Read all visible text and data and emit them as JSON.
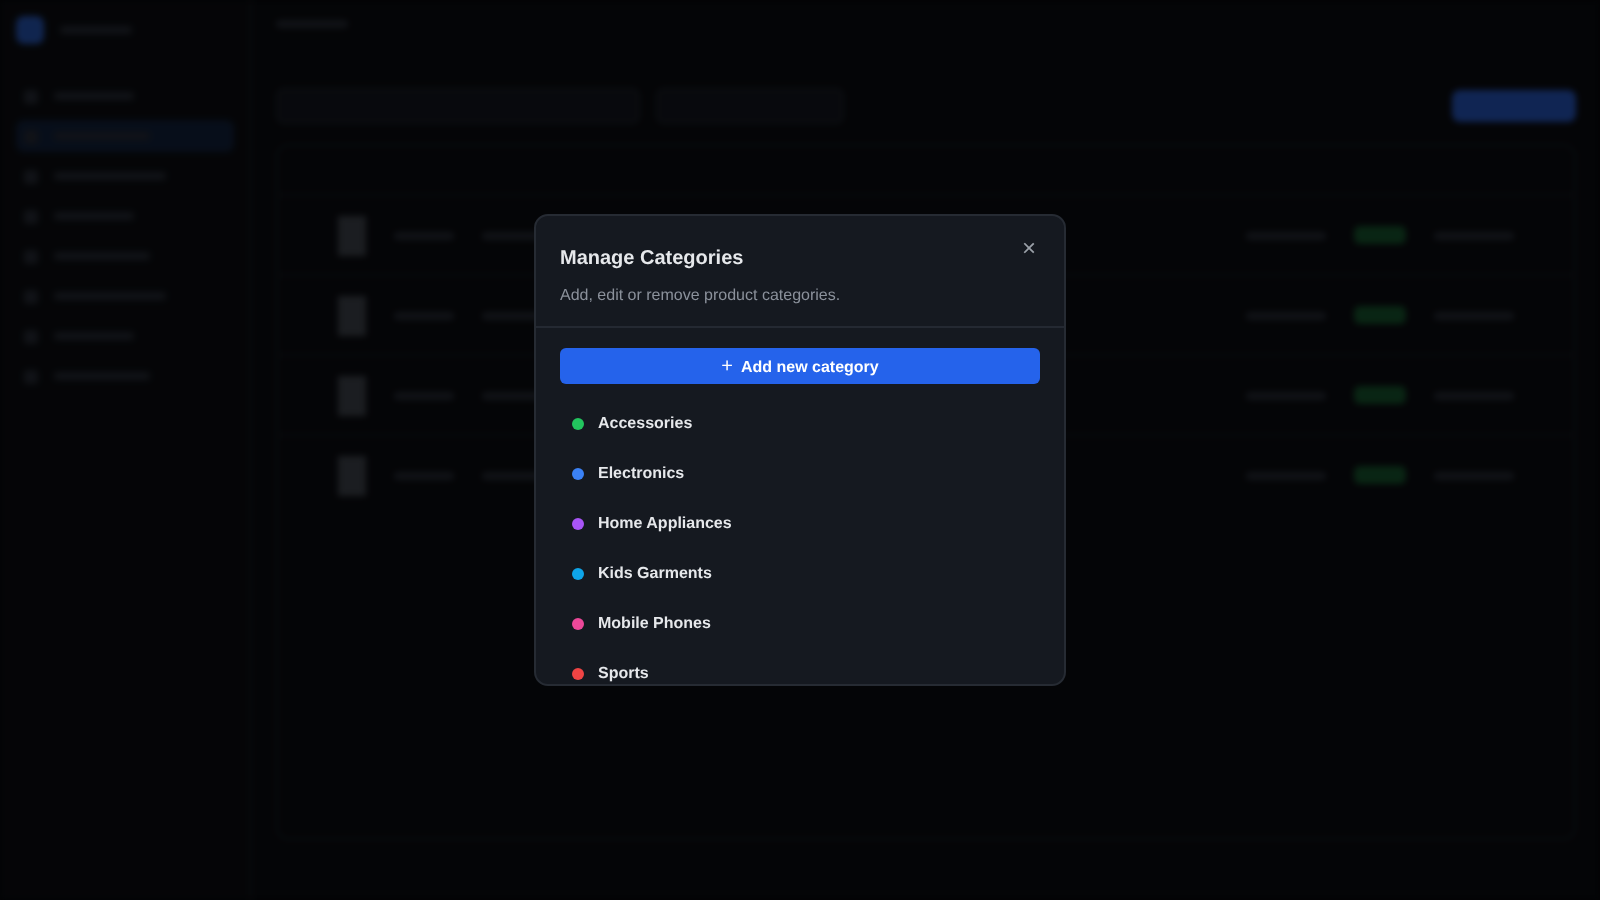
{
  "dialog": {
    "title": "Manage Categories",
    "subtitle": "Add, edit or remove product categories.",
    "close_icon": "×",
    "add_button": {
      "icon": "+",
      "label": "Add new category"
    },
    "categories": [
      {
        "name": "Accessories",
        "color": "#22c55e"
      },
      {
        "name": "Electronics",
        "color": "#3b82f6"
      },
      {
        "name": "Home Appliances",
        "color": "#a855f7"
      },
      {
        "name": "Kids Garments",
        "color": "#0ea5e9"
      },
      {
        "name": "Mobile Phones",
        "color": "#ec4899"
      },
      {
        "name": "Sports",
        "color": "#ef4444"
      }
    ]
  }
}
